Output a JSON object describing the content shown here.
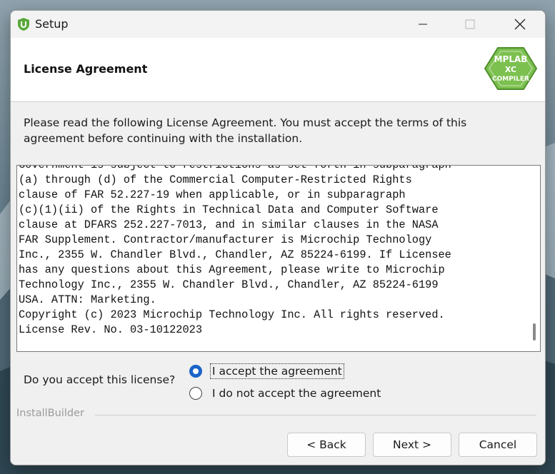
{
  "window": {
    "title": "Setup"
  },
  "header": {
    "title": "License Agreement",
    "logo": {
      "line1": "MPLAB",
      "line2": "XC",
      "line3": "COMPILER"
    }
  },
  "intro_text": "Please read the following License Agreement. You must accept the terms of this agreement before continuing with the installation.",
  "license": {
    "lines": [
      "Government is subject to restrictions as set forth in subparagraph",
      "(a) through (d) of the Commercial Computer-Restricted Rights",
      "clause of FAR 52.227-19 when applicable, or in subparagraph",
      "(c)(1)(ii) of the Rights in Technical Data and Computer Software",
      "clause at DFARS 252.227-7013, and in similar clauses in the NASA",
      "FAR Supplement. Contractor/manufacturer is Microchip Technology",
      "Inc., 2355 W. Chandler Blvd., Chandler, AZ 85224-6199. If Licensee",
      "has any questions about this Agreement, please write to Microchip",
      "Technology Inc., 2355 W. Chandler Blvd., Chandler, AZ 85224-6199",
      "USA. ATTN: Marketing.",
      "Copyright (c) 2023 Microchip Technology Inc. All rights reserved.",
      "License Rev. No. 03-10122023"
    ],
    "scroll_position": 0.95
  },
  "acceptance": {
    "question": "Do you accept this license?",
    "options": [
      {
        "label": "I accept the agreement",
        "selected": true
      },
      {
        "label": "I do not accept the agreement",
        "selected": false
      }
    ]
  },
  "footer": {
    "brand": "InstallBuilder",
    "back_label": "< Back",
    "next_label": "Next >",
    "cancel_label": "Cancel"
  },
  "colors": {
    "accent": "#1a64c8",
    "logo_green": "#6ab04c"
  }
}
